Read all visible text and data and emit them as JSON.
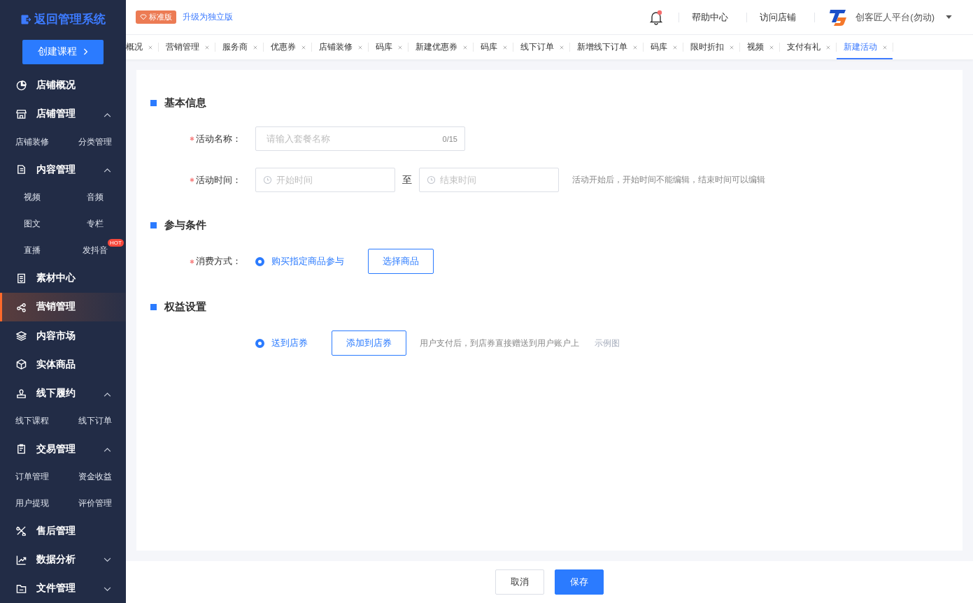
{
  "sidebar": {
    "back_title": "返回管理系统",
    "create_button": "创建课程",
    "items": [
      {
        "label": "店铺概况",
        "selected": false
      },
      {
        "label": "店铺管理",
        "selected": false,
        "expanded": true,
        "children": [
          {
            "label": "店铺装修"
          },
          {
            "label": "分类管理"
          }
        ]
      },
      {
        "label": "内容管理",
        "selected": false,
        "expanded": true,
        "children": [
          {
            "label": "视频"
          },
          {
            "label": "音频"
          },
          {
            "label": "图文"
          },
          {
            "label": "专栏"
          },
          {
            "label": "直播"
          },
          {
            "label": "发抖音",
            "badge": "HOT"
          }
        ]
      },
      {
        "label": "素材中心",
        "selected": false
      },
      {
        "label": "营销管理",
        "selected": true
      },
      {
        "label": "内容市场",
        "selected": false
      },
      {
        "label": "实体商品",
        "selected": false
      },
      {
        "label": "线下履约",
        "selected": false,
        "expanded": true,
        "children": [
          {
            "label": "线下课程"
          },
          {
            "label": "线下订单"
          }
        ]
      },
      {
        "label": "交易管理",
        "selected": false,
        "expanded": true,
        "children": [
          {
            "label": "订单管理"
          },
          {
            "label": "资金收益"
          },
          {
            "label": "用户提现"
          },
          {
            "label": "评价管理"
          }
        ]
      },
      {
        "label": "售后管理",
        "selected": false
      },
      {
        "label": "数据分析",
        "selected": false,
        "expanded": false
      },
      {
        "label": "文件管理",
        "selected": false,
        "expanded": false
      }
    ]
  },
  "header": {
    "edition_badge": "标准版",
    "upgrade_link": "升级为独立版",
    "notification_dot": true,
    "links": [
      "帮助中心",
      "访问店铺"
    ],
    "account": "创客匠人平台(勿动)"
  },
  "tabs": [
    {
      "label": "概况",
      "selected": false
    },
    {
      "label": "营销管理",
      "selected": false
    },
    {
      "label": "服务商",
      "selected": false
    },
    {
      "label": "优惠券",
      "selected": false
    },
    {
      "label": "店铺装修",
      "selected": false
    },
    {
      "label": "码库",
      "selected": false
    },
    {
      "label": "新建优惠券",
      "selected": false
    },
    {
      "label": "码库",
      "selected": false
    },
    {
      "label": "线下订单",
      "selected": false
    },
    {
      "label": "新增线下订单",
      "selected": false
    },
    {
      "label": "码库",
      "selected": false
    },
    {
      "label": "限时折扣",
      "selected": false
    },
    {
      "label": "视频",
      "selected": false
    },
    {
      "label": "支付有礼",
      "selected": false
    },
    {
      "label": "新建活动",
      "selected": true
    }
  ],
  "sections": [
    {
      "title": "基本信息",
      "rows": [
        {
          "kind": "text",
          "label": "活动名称：",
          "required": true,
          "placeholder": "请输入套餐名称",
          "counter": "0/15"
        },
        {
          "kind": "daterange",
          "label": "活动时间：",
          "required": true,
          "start_placeholder": "开始时间",
          "separator": "至",
          "end_placeholder": "结束时间",
          "hint": "活动开始后，开始时间不能编辑，结束时间可以编辑"
        }
      ]
    },
    {
      "title": "参与条件",
      "rows": [
        {
          "kind": "radio",
          "label": "消费方式：",
          "required": true,
          "option": {
            "label": "购买指定商品参与",
            "selected": true
          },
          "button": "选择商品"
        }
      ]
    },
    {
      "title": "权益设置",
      "rows": [
        {
          "kind": "radio",
          "required": false,
          "option": {
            "label": "送到店券",
            "selected": true
          },
          "button": "添加到店券",
          "hint": "用户支付后，到店券直接赠送到用户账户上",
          "link": "示例图"
        }
      ]
    }
  ],
  "footer": {
    "cancel": "取消",
    "save": "保存"
  }
}
